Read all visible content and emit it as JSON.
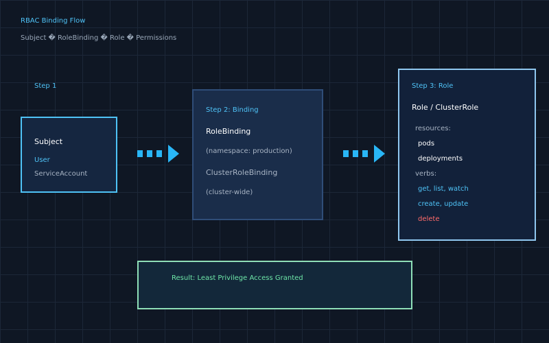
{
  "header": {
    "title": "RBAC Binding Flow",
    "subtitle": "Subject � RoleBinding � Role � Permissions"
  },
  "step1": {
    "label": "Step 1",
    "box_title": "Subject",
    "kind_user": "User",
    "kind_sa": "ServiceAccount"
  },
  "step2": {
    "label": "Step 2: Binding",
    "rolebinding": "RoleBinding",
    "rolebinding_scope": "(namespace: production)",
    "clusterrolebinding": "ClusterRoleBinding",
    "clusterrolebinding_scope": "(cluster-wide)"
  },
  "step3": {
    "label": "Step 3: Role",
    "title": "Role / ClusterRole",
    "resources_label": "resources:",
    "resources": [
      "pods",
      "deployments"
    ],
    "verbs_label": "verbs:",
    "verbs": [
      "get, list, watch",
      "create, update",
      "delete"
    ]
  },
  "result": {
    "text": "Result: Least Privilege Access Granted"
  },
  "colors": {
    "accent": "#4fc3f7",
    "danger": "#ff6b6b",
    "success": "#6ee7a8",
    "background": "#0f1724"
  },
  "icons": [
    "dashed-arrow-right-icon",
    "dashed-arrow-right-icon"
  ]
}
